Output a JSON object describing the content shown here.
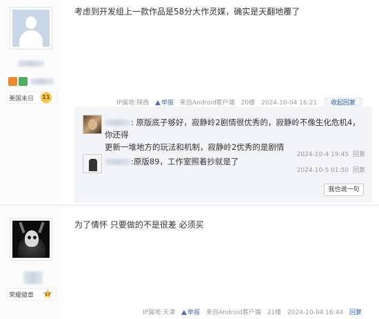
{
  "posts": [
    {
      "level_name": "美国末日",
      "level": "11",
      "content": "考虑到开发组上一款作品是58分大作灵媒，确实是天翻地覆了",
      "meta": {
        "ip": "IP属地:陕西",
        "report": "举报",
        "source": "来自Android客户端",
        "floor": "20楼",
        "time": "2024-10-04 16:21",
        "reply": "收起回复"
      },
      "replies": [
        {
          "text_lines": [
            ": 原版底子够好，寂静岭2剧情很优秀的，寂静岭不像生化危机4，你还得",
            "更新一堆地方的玩法和机制，寂静岭2优秀的是剧情"
          ],
          "time": "2024-10-4 19:45",
          "reply": "回复"
        },
        {
          "text_lines": ":原版89，工作室照着抄就是了",
          "time": "2024-10-5 01:50",
          "reply": "回复"
        }
      ],
      "say_button": "我也说一句"
    },
    {
      "level_name": "荣耀徽章",
      "level": "17",
      "content": "为了情怀 只要做的不是很差 必须买",
      "meta": {
        "ip": "IP属地:天津",
        "report": "举报",
        "source": "来自Android客户端",
        "floor": "21楼",
        "time": "2024-10-04 16:44",
        "reply": "回复"
      }
    }
  ],
  "colors": {
    "link": "#2d64b3",
    "level_badge": "#f6c545",
    "reply_bg": "#f3f4f7"
  }
}
